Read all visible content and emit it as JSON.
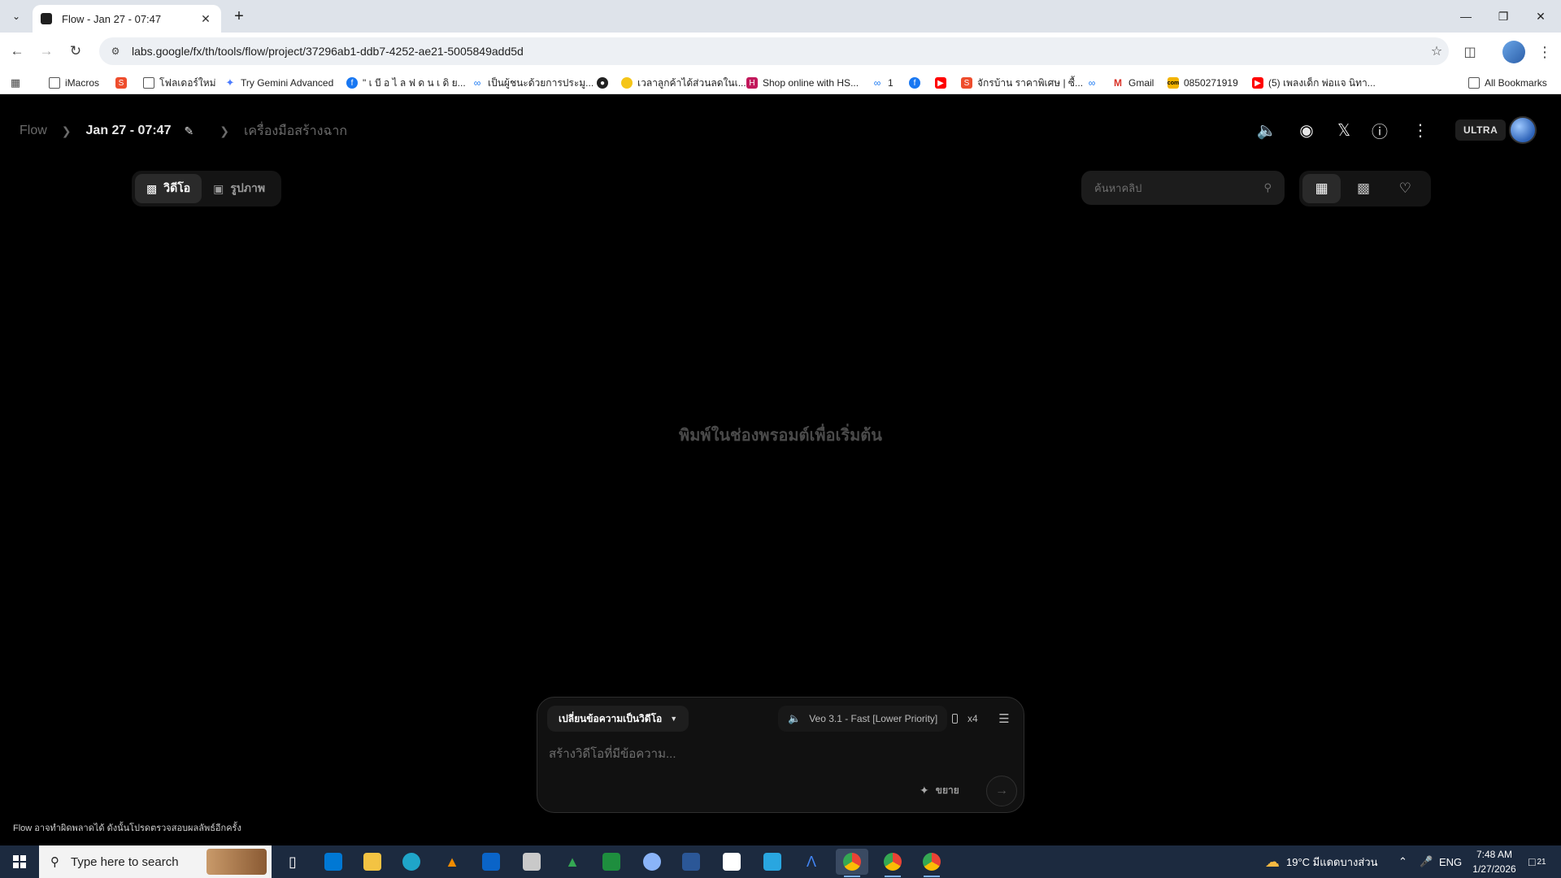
{
  "browser": {
    "tab_title": "Flow - Jan 27 - 07:47",
    "url": "labs.google/fx/th/tools/flow/project/37296ab1-ddb7-4252-ae21-5005849add5d",
    "bookmarks": [
      {
        "label": "iMacros",
        "icon": "folder-icon"
      },
      {
        "label": "",
        "icon": "shopee-icon"
      },
      {
        "label": "โฟลเดอร์ใหม่",
        "icon": "folder-icon"
      },
      {
        "label": "Try Gemini Advanced",
        "icon": "gemini-icon"
      },
      {
        "label": "\" เ บี อ ไ ล ฟ ด น เ ดิ ย...",
        "icon": "facebook-icon"
      },
      {
        "label": "เป็นผู้ชนะด้วยการประมู...",
        "icon": "meta-icon"
      },
      {
        "label": "",
        "icon": "globe-icon"
      },
      {
        "label": "เวลาลูกค้าได้ส่วนลดในเ...",
        "icon": "emoji-icon"
      },
      {
        "label": "Shop online with HS...",
        "icon": "hs-icon"
      },
      {
        "label": "1",
        "icon": "meta-icon"
      },
      {
        "label": "",
        "icon": "facebook-icon"
      },
      {
        "label": "",
        "icon": "youtube-icon"
      },
      {
        "label": "จักรบ้าน ราคาพิเศษ | ซื้...",
        "icon": "shopee-icon"
      },
      {
        "label": "",
        "icon": "meta-icon"
      },
      {
        "label": "Gmail",
        "icon": "gmail-icon"
      },
      {
        "label": "0850271919",
        "icon": "com-icon"
      },
      {
        "label": "(5) เพลงเด็ก พ่อแจ นิทา...",
        "icon": "youtube-icon"
      }
    ],
    "all_bookmarks": "All Bookmarks"
  },
  "app": {
    "breadcrumb": {
      "root": "Flow",
      "project": "Jan 27 - 07:47",
      "tool": "เครื่องมือสร้างฉาก"
    },
    "badge": "ULTRA",
    "modes": {
      "video": "วิดีโอ",
      "image": "รูปภาพ"
    },
    "search_placeholder": "ค้นหาคลิป",
    "empty_message": "พิมพ์ในช่องพรอมต์เพื่อเริ่มต้น",
    "composer": {
      "mode_label": "เปลี่ยนข้อความเป็นวิดีโอ",
      "model_label": "Veo 3.1 - Fast [Lower Priority]",
      "count_label": "x4",
      "prompt_placeholder": "สร้างวิดีโอที่มีข้อความ...",
      "expand_label": "ขยาย"
    },
    "disclaimer": "Flow อาจทำผิดพลาดได้ ดังนั้นโปรดตรวจสอบผลลัพธ์อีกครั้ง"
  },
  "taskbar": {
    "search_text": "Type here to search",
    "weather": "19°C  มีแดดบางส่วน",
    "lang": "ENG",
    "time": "7:48 AM",
    "date": "1/27/2026",
    "notifications": "21"
  }
}
